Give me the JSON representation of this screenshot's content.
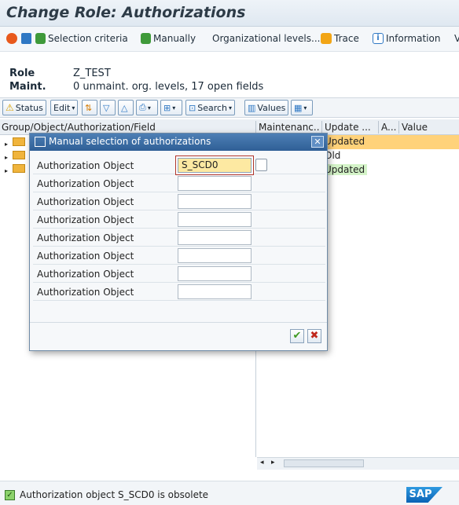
{
  "window": {
    "title": "Change Role: Authorizations"
  },
  "toolbar": {
    "items": [
      {
        "label": "",
        "icon": "plan-icon"
      },
      {
        "label": "",
        "icon": "trash-icon"
      },
      {
        "label": "Selection criteria",
        "icon": "add-node-icon"
      },
      {
        "label": "Manually",
        "icon": "add-node-icon"
      },
      {
        "label": "Organizational levels...",
        "icon": ""
      },
      {
        "label": "Trace",
        "icon": "trace-icon"
      },
      {
        "label": "Information",
        "icon": "info-icon"
      },
      {
        "label": "V",
        "icon": ""
      }
    ]
  },
  "header": {
    "role_label": "Role",
    "role_value": "Z_TEST",
    "maint_label": "Maint.",
    "maint_value": "0 unmaint. org. levels, 17 open fields"
  },
  "subtoolbar": {
    "status": "Status",
    "edit": "Edit",
    "search": "Search",
    "values": "Values"
  },
  "grid": {
    "columns": [
      "Group/Object/Authorization/Field",
      "Maintenanc...",
      "Update ...",
      "A...",
      "Value"
    ],
    "rows": [
      {
        "update": "Updated",
        "highlight": "#ffd27a"
      },
      {
        "update": "Old",
        "highlight": ""
      },
      {
        "update": "Updated",
        "highlight": "#d4f3c8"
      }
    ]
  },
  "dialog": {
    "title": "Manual selection of authorizations",
    "fields": [
      {
        "label": "Authorization Object",
        "value": "S_SCD0"
      },
      {
        "label": "Authorization Object",
        "value": ""
      },
      {
        "label": "Authorization Object",
        "value": ""
      },
      {
        "label": "Authorization Object",
        "value": ""
      },
      {
        "label": "Authorization Object",
        "value": ""
      },
      {
        "label": "Authorization Object",
        "value": ""
      },
      {
        "label": "Authorization Object",
        "value": ""
      },
      {
        "label": "Authorization Object",
        "value": ""
      }
    ],
    "ok_glyph": "✔",
    "cancel_glyph": "✖"
  },
  "statusbar": {
    "message": "Authorization object S_SCD0 is obsolete",
    "logo": "SAP"
  },
  "colors": {
    "title_text": "#2d3b47",
    "dialog_title_bg": "#2f5f96",
    "active_field_bg": "#fde9a2",
    "updated_orange": "#ffd27a",
    "updated_green": "#d4f3c8"
  }
}
